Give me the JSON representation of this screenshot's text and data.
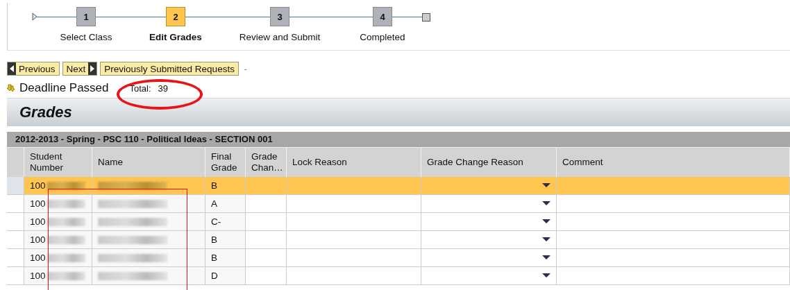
{
  "roadmap": {
    "steps": [
      {
        "number": "1",
        "label": "Select Class",
        "selected": false
      },
      {
        "number": "2",
        "label": "Edit Grades",
        "selected": true
      },
      {
        "number": "3",
        "label": "Review and Submit",
        "selected": false
      },
      {
        "number": "4",
        "label": "Completed",
        "selected": false
      }
    ]
  },
  "toolbar": {
    "buttons": [
      {
        "label": "Previous",
        "kind": "prev"
      },
      {
        "label": "Next",
        "kind": "next"
      },
      {
        "label": "Previously Submitted Requests",
        "kind": "plain"
      }
    ],
    "separator": "-"
  },
  "status": {
    "message": "Deadline Passed",
    "total_label": "Total:",
    "total_value": "39"
  },
  "panel": {
    "title": "Grades"
  },
  "table": {
    "caption": "2012-2013 - Spring - PSC 110 - Political Ideas - SECTION 001",
    "columns": [
      {
        "label": "Student Number",
        "kind": "number"
      },
      {
        "label": "Name",
        "kind": "redacted"
      },
      {
        "label": "Final Grade",
        "kind": "grade"
      },
      {
        "label": "Grade Chan…",
        "kind": "blank"
      },
      {
        "label": "Lock Reason",
        "kind": "blank"
      },
      {
        "label": "Grade Change Reason",
        "kind": "dropdown"
      },
      {
        "label": "Comment",
        "kind": "blank"
      }
    ],
    "rows": [
      {
        "student_number": "100",
        "final_grade": "B",
        "selected": true
      },
      {
        "student_number": "100",
        "final_grade": "A",
        "selected": false
      },
      {
        "student_number": "100",
        "final_grade": "C-",
        "selected": false
      },
      {
        "student_number": "100",
        "final_grade": "B",
        "selected": false
      },
      {
        "student_number": "100",
        "final_grade": "B",
        "selected": false
      },
      {
        "student_number": "100",
        "final_grade": "D",
        "selected": false
      }
    ]
  },
  "annotations": [
    {
      "kind": "ellipse"
    },
    {
      "kind": "rectangle"
    }
  ]
}
